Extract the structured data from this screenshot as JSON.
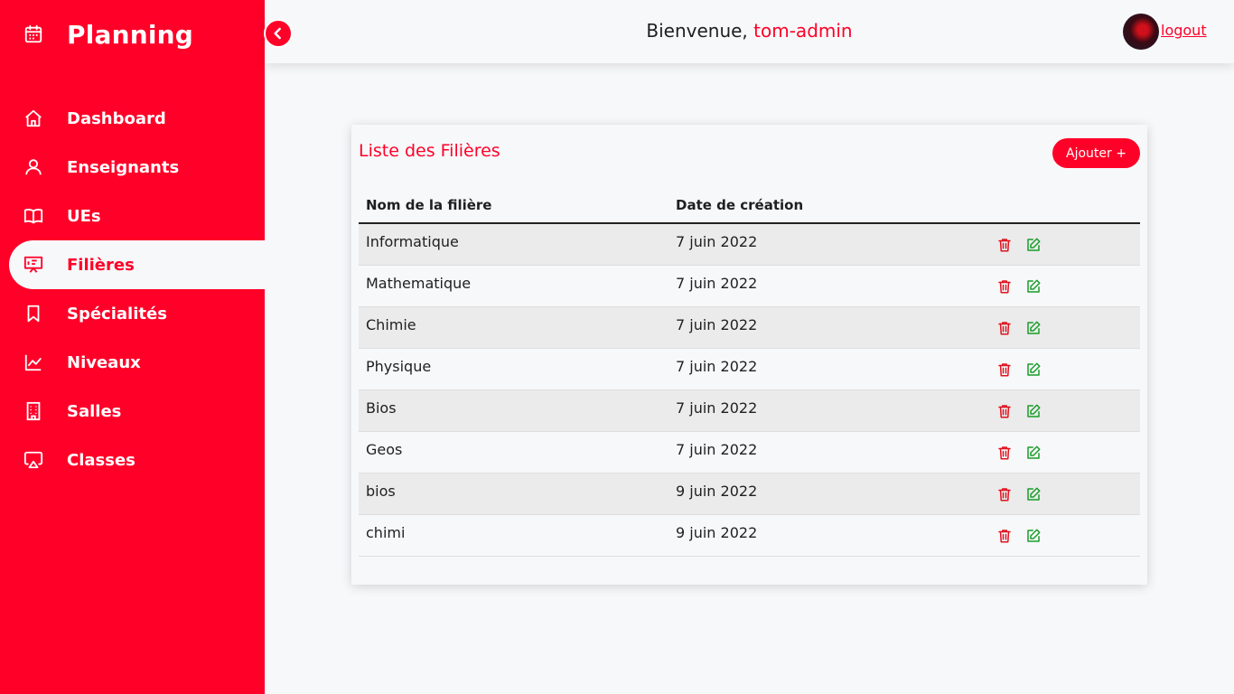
{
  "sidebar": {
    "brand": "Planning",
    "items": [
      {
        "label": "Dashboard",
        "icon": "home-icon"
      },
      {
        "label": "Enseignants",
        "icon": "user-icon"
      },
      {
        "label": "UEs",
        "icon": "book-icon"
      },
      {
        "label": "Filières",
        "icon": "presentation-icon",
        "active": true
      },
      {
        "label": "Spécialités",
        "icon": "bookmark-icon"
      },
      {
        "label": "Niveaux",
        "icon": "chart-line-icon"
      },
      {
        "label": "Salles",
        "icon": "building-icon"
      },
      {
        "label": "Classes",
        "icon": "airplay-icon"
      }
    ]
  },
  "header": {
    "welcome_prefix": "Bienvenue, ",
    "username": "tom-admin",
    "logout": "logout"
  },
  "card": {
    "title": "Liste des Filières",
    "add_label": "Ajouter +",
    "columns": [
      "Nom de la filière",
      "Date de création",
      ""
    ],
    "rows": [
      {
        "name": "Informatique",
        "date": "7 juin 2022"
      },
      {
        "name": "Mathematique",
        "date": "7 juin 2022"
      },
      {
        "name": "Chimie",
        "date": "7 juin 2022"
      },
      {
        "name": "Physique",
        "date": "7 juin 2022"
      },
      {
        "name": "Bios",
        "date": "7 juin 2022"
      },
      {
        "name": "Geos",
        "date": "7 juin 2022"
      },
      {
        "name": "bios",
        "date": "9 juin 2022"
      },
      {
        "name": "chimi",
        "date": "9 juin 2022"
      }
    ]
  },
  "colors": {
    "accent": "#ff0028",
    "edit": "#1a9c2a",
    "background": "#f7f8fa"
  }
}
